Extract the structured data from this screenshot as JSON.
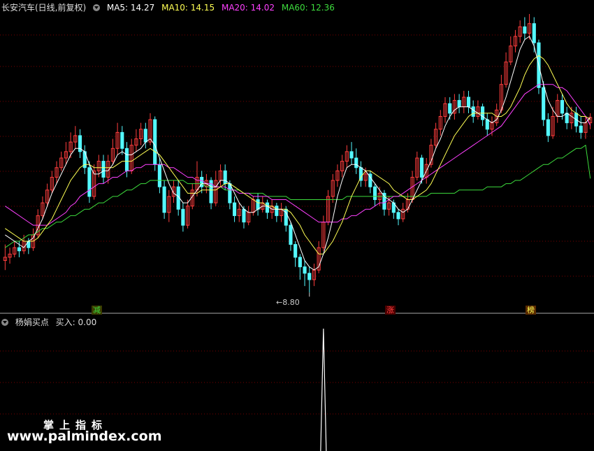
{
  "header_top": {
    "title": "长安汽车(日线,前复权)",
    "ma5_label": "MA5: 14.27",
    "ma10_label": "MA10: 14.15",
    "ma20_label": "MA20: 14.02",
    "ma60_label": "MA60: 12.36"
  },
  "header_bottom": {
    "title": "杨娟买点",
    "value_label": "买入: 0.00"
  },
  "annotations": {
    "low_marker": "←8.80",
    "badge_1": "减",
    "badge_2": "涨",
    "badge_3": "榜"
  },
  "watermark": {
    "line1": "掌上指标",
    "line2": "www.palmindex.com"
  },
  "colors": {
    "up": "#ff3d3d",
    "down": "#54f8ff",
    "ma5": "#ffffff",
    "ma10": "#ffff54",
    "ma20": "#ff40ff",
    "ma60": "#3ddc3d",
    "grid": "#7a0000",
    "divider": "#aaaaaa"
  },
  "chart_data": {
    "type": "candlestick",
    "ylim": [
      8.5,
      17.5
    ],
    "low_value": 8.8,
    "candles": [
      [
        9.8,
        9.9,
        9.5,
        10.3
      ],
      [
        9.9,
        10.0,
        9.7,
        10.2
      ],
      [
        10.0,
        10.2,
        9.9,
        10.4
      ],
      [
        10.2,
        10.1,
        9.9,
        10.4
      ],
      [
        10.1,
        10.4,
        10.0,
        10.6
      ],
      [
        10.4,
        10.2,
        10.0,
        10.5
      ],
      [
        10.2,
        10.6,
        10.1,
        10.8
      ],
      [
        10.6,
        11.2,
        10.5,
        11.4
      ],
      [
        11.2,
        11.6,
        11.1,
        11.8
      ],
      [
        11.6,
        12.0,
        11.5,
        12.2
      ],
      [
        12.0,
        12.4,
        11.9,
        12.6
      ],
      [
        12.4,
        12.7,
        12.2,
        12.9
      ],
      [
        12.7,
        13.0,
        12.6,
        13.2
      ],
      [
        13.0,
        13.2,
        12.8,
        13.5
      ],
      [
        13.2,
        13.5,
        13.0,
        13.8
      ],
      [
        13.5,
        13.7,
        13.3,
        14.0
      ],
      [
        13.7,
        13.2,
        13.0,
        13.9
      ],
      [
        13.2,
        12.7,
        12.5,
        13.4
      ],
      [
        12.7,
        11.8,
        11.6,
        12.9
      ],
      [
        11.8,
        12.6,
        11.7,
        12.8
      ],
      [
        12.6,
        12.9,
        12.4,
        13.1
      ],
      [
        12.9,
        12.4,
        12.2,
        13.1
      ],
      [
        12.4,
        12.9,
        12.2,
        13.1
      ],
      [
        12.9,
        13.3,
        12.8,
        13.6
      ],
      [
        13.3,
        13.8,
        13.1,
        14.1
      ],
      [
        13.8,
        13.3,
        13.1,
        14.0
      ],
      [
        13.3,
        12.6,
        12.4,
        13.5
      ],
      [
        12.6,
        13.4,
        12.5,
        13.6
      ],
      [
        13.4,
        13.6,
        13.2,
        13.9
      ],
      [
        13.6,
        13.9,
        13.4,
        14.1
      ],
      [
        13.9,
        13.5,
        13.3,
        14.1
      ],
      [
        13.5,
        14.2,
        13.4,
        14.4
      ],
      [
        14.2,
        12.8,
        12.6,
        14.3
      ],
      [
        12.8,
        12.1,
        11.9,
        13.0
      ],
      [
        12.1,
        11.3,
        11.1,
        12.3
      ],
      [
        11.3,
        11.8,
        11.0,
        12.0
      ],
      [
        11.8,
        12.1,
        11.6,
        12.3
      ],
      [
        12.1,
        11.4,
        11.2,
        12.3
      ],
      [
        11.4,
        10.9,
        10.7,
        11.6
      ],
      [
        10.9,
        11.5,
        10.8,
        11.7
      ],
      [
        11.5,
        12.0,
        11.4,
        12.2
      ],
      [
        12.0,
        12.4,
        11.8,
        12.9
      ],
      [
        12.4,
        12.1,
        11.9,
        12.6
      ],
      [
        12.1,
        12.3,
        11.9,
        12.5
      ],
      [
        12.3,
        11.6,
        11.4,
        12.4
      ],
      [
        11.6,
        12.3,
        11.5,
        12.6
      ],
      [
        12.3,
        12.6,
        12.1,
        12.8
      ],
      [
        12.6,
        12.2,
        12.0,
        12.8
      ],
      [
        12.2,
        11.6,
        11.4,
        12.3
      ],
      [
        11.6,
        11.2,
        11.0,
        11.8
      ],
      [
        11.2,
        11.4,
        11.0,
        11.6
      ],
      [
        11.4,
        11.0,
        10.8,
        11.5
      ],
      [
        11.0,
        11.3,
        10.9,
        11.5
      ],
      [
        11.3,
        11.7,
        11.2,
        11.8
      ],
      [
        11.7,
        11.4,
        11.2,
        11.9
      ],
      [
        11.4,
        11.6,
        11.3,
        11.8
      ],
      [
        11.6,
        11.3,
        11.1,
        11.7
      ],
      [
        11.3,
        11.5,
        11.1,
        11.7
      ],
      [
        11.5,
        11.2,
        11.0,
        11.6
      ],
      [
        11.2,
        11.4,
        11.0,
        11.6
      ],
      [
        11.4,
        10.9,
        10.7,
        11.5
      ],
      [
        10.9,
        10.3,
        10.1,
        11.0
      ],
      [
        10.3,
        9.9,
        9.6,
        10.4
      ],
      [
        9.9,
        9.6,
        9.2,
        10.0
      ],
      [
        9.6,
        9.4,
        9.0,
        9.8
      ],
      [
        9.4,
        9.2,
        8.8,
        9.6
      ],
      [
        9.2,
        9.5,
        9.0,
        9.7
      ],
      [
        9.5,
        10.2,
        9.4,
        10.4
      ],
      [
        10.2,
        11.0,
        10.1,
        11.2
      ],
      [
        11.0,
        11.8,
        10.9,
        12.0
      ],
      [
        11.8,
        12.3,
        11.6,
        12.5
      ],
      [
        12.3,
        12.6,
        12.1,
        12.8
      ],
      [
        12.6,
        12.9,
        12.4,
        13.1
      ],
      [
        12.9,
        13.2,
        12.7,
        13.4
      ],
      [
        13.2,
        13.0,
        12.8,
        13.5
      ],
      [
        13.0,
        12.7,
        12.5,
        13.3
      ],
      [
        12.7,
        12.3,
        12.1,
        12.9
      ],
      [
        12.3,
        12.5,
        12.1,
        12.7
      ],
      [
        12.5,
        12.1,
        11.9,
        12.6
      ],
      [
        12.1,
        11.7,
        11.5,
        12.2
      ],
      [
        11.7,
        11.9,
        11.5,
        12.1
      ],
      [
        11.9,
        11.4,
        11.2,
        12.0
      ],
      [
        11.4,
        11.6,
        11.2,
        11.8
      ],
      [
        11.6,
        11.3,
        11.1,
        11.7
      ],
      [
        11.3,
        11.1,
        10.9,
        11.4
      ],
      [
        11.1,
        11.4,
        11.0,
        11.6
      ],
      [
        11.4,
        11.7,
        11.3,
        11.9
      ],
      [
        11.7,
        12.4,
        11.6,
        12.6
      ],
      [
        12.4,
        13.0,
        12.3,
        13.2
      ],
      [
        13.0,
        12.4,
        12.2,
        13.1
      ],
      [
        12.4,
        12.8,
        12.2,
        13.0
      ],
      [
        12.8,
        13.4,
        12.7,
        13.6
      ],
      [
        13.4,
        13.9,
        13.3,
        14.1
      ],
      [
        13.9,
        14.3,
        13.7,
        14.5
      ],
      [
        14.3,
        14.7,
        14.1,
        14.9
      ],
      [
        14.7,
        14.4,
        14.2,
        14.9
      ],
      [
        14.4,
        14.8,
        14.2,
        15.0
      ],
      [
        14.8,
        14.6,
        14.4,
        15.0
      ],
      [
        14.6,
        14.9,
        14.4,
        15.1
      ],
      [
        14.9,
        14.6,
        14.4,
        15.1
      ],
      [
        14.6,
        14.3,
        14.1,
        14.8
      ],
      [
        14.3,
        14.6,
        14.2,
        14.8
      ],
      [
        14.6,
        14.2,
        14.0,
        14.7
      ],
      [
        14.2,
        13.9,
        13.7,
        14.4
      ],
      [
        13.9,
        14.1,
        13.7,
        14.3
      ],
      [
        14.1,
        14.5,
        14.0,
        14.7
      ],
      [
        14.5,
        15.3,
        14.4,
        15.6
      ],
      [
        15.3,
        16.0,
        15.2,
        16.3
      ],
      [
        16.0,
        16.5,
        15.9,
        16.8
      ],
      [
        16.5,
        16.8,
        16.3,
        17.0
      ],
      [
        16.8,
        17.1,
        16.6,
        17.3
      ],
      [
        17.1,
        16.9,
        16.7,
        17.4
      ],
      [
        16.9,
        17.2,
        16.7,
        17.5
      ],
      [
        17.2,
        16.6,
        16.3,
        17.4
      ],
      [
        16.6,
        15.2,
        15.0,
        16.7
      ],
      [
        15.2,
        14.2,
        14.0,
        15.4
      ],
      [
        14.2,
        13.7,
        13.5,
        14.4
      ],
      [
        13.7,
        14.3,
        13.6,
        14.6
      ],
      [
        14.3,
        14.8,
        14.1,
        15.0
      ],
      [
        14.8,
        14.4,
        14.2,
        15.0
      ],
      [
        14.4,
        14.1,
        13.9,
        14.6
      ],
      [
        14.1,
        14.4,
        13.9,
        14.6
      ],
      [
        14.4,
        14.0,
        13.8,
        14.6
      ],
      [
        14.0,
        13.8,
        13.6,
        14.3
      ],
      [
        13.8,
        14.1,
        13.6,
        14.3
      ],
      [
        14.1,
        14.27,
        13.9,
        14.4
      ]
    ],
    "ma5": [
      10.6,
      10.5,
      10.4,
      10.3,
      10.2,
      10.4,
      10.5,
      10.8,
      11.1,
      11.5,
      11.9,
      12.2,
      12.5,
      12.8,
      13.1,
      13.3,
      13.3,
      13.2,
      12.8,
      12.5,
      12.5,
      12.6,
      12.6,
      12.8,
      13.1,
      13.2,
      13.1,
      13.1,
      13.2,
      13.3,
      13.5,
      13.6,
      13.4,
      13.0,
      12.6,
      12.2,
      11.9,
      11.8,
      11.6,
      11.6,
      11.8,
      12.0,
      12.2,
      12.2,
      12.1,
      12.1,
      12.3,
      12.3,
      12.2,
      11.9,
      11.6,
      11.4,
      11.3,
      11.3,
      11.4,
      11.5,
      11.5,
      11.4,
      11.4,
      11.4,
      11.3,
      11.0,
      10.6,
      10.2,
      9.8,
      9.6,
      9.5,
      9.6,
      10.0,
      10.5,
      11.1,
      11.8,
      12.3,
      12.7,
      12.8,
      12.8,
      12.7,
      12.6,
      12.4,
      12.2,
      12.0,
      11.8,
      11.7,
      11.6,
      11.4,
      11.3,
      11.4,
      11.7,
      12.0,
      12.3,
      12.6,
      12.9,
      13.3,
      13.6,
      14.0,
      14.3,
      14.5,
      14.6,
      14.6,
      14.6,
      14.5,
      14.4,
      14.3,
      14.2,
      14.1,
      14.2,
      14.5,
      14.9,
      15.4,
      15.9,
      16.4,
      16.7,
      16.8,
      16.5,
      15.9,
      15.3,
      14.8,
      14.5,
      14.3,
      14.3,
      14.4,
      14.3,
      14.2,
      14.1,
      14.1,
      14.27
    ],
    "ma10": [
      10.8,
      10.7,
      10.6,
      10.5,
      10.4,
      10.4,
      10.4,
      10.5,
      10.7,
      10.9,
      11.1,
      11.4,
      11.7,
      12.0,
      12.3,
      12.5,
      12.7,
      12.8,
      12.8,
      12.7,
      12.7,
      12.7,
      12.7,
      12.7,
      12.8,
      12.9,
      12.9,
      12.9,
      13.0,
      13.1,
      13.2,
      13.3,
      13.2,
      13.1,
      12.9,
      12.7,
      12.5,
      12.3,
      12.1,
      11.9,
      11.9,
      11.9,
      12.0,
      12.0,
      12.0,
      12.0,
      12.1,
      12.2,
      12.2,
      12.1,
      12.0,
      11.9,
      11.8,
      11.7,
      11.6,
      11.6,
      11.5,
      11.5,
      11.4,
      11.4,
      11.4,
      11.3,
      11.1,
      10.9,
      10.6,
      10.4,
      10.2,
      10.0,
      10.0,
      10.2,
      10.4,
      10.7,
      11.0,
      11.4,
      11.8,
      12.1,
      12.4,
      12.6,
      12.6,
      12.5,
      12.4,
      12.3,
      12.2,
      12.0,
      11.9,
      11.8,
      11.7,
      11.7,
      11.8,
      11.9,
      12.0,
      12.2,
      12.5,
      12.8,
      13.1,
      13.4,
      13.7,
      13.9,
      14.1,
      14.3,
      14.4,
      14.4,
      14.4,
      14.4,
      14.4,
      14.3,
      14.3,
      14.4,
      14.6,
      14.9,
      15.2,
      15.6,
      15.9,
      16.1,
      16.2,
      16.1,
      15.9,
      15.6,
      15.3,
      15.0,
      14.7,
      14.5,
      14.4,
      14.3,
      14.3,
      14.2,
      14.15
    ],
    "ma20": [
      11.5,
      11.4,
      11.3,
      11.2,
      11.1,
      11.0,
      10.9,
      10.9,
      10.9,
      10.9,
      11.0,
      11.1,
      11.2,
      11.3,
      11.5,
      11.6,
      11.8,
      11.9,
      12.0,
      12.1,
      12.2,
      12.2,
      12.3,
      12.4,
      12.4,
      12.5,
      12.6,
      12.6,
      12.7,
      12.7,
      12.8,
      12.8,
      12.8,
      12.8,
      12.8,
      12.7,
      12.7,
      12.6,
      12.5,
      12.4,
      12.4,
      12.3,
      12.3,
      12.2,
      12.2,
      12.1,
      12.1,
      12.1,
      12.0,
      12.0,
      11.9,
      11.9,
      11.9,
      11.8,
      11.8,
      11.8,
      11.8,
      11.7,
      11.7,
      11.7,
      11.7,
      11.6,
      11.5,
      11.4,
      11.3,
      11.2,
      11.1,
      11.0,
      11.0,
      11.0,
      11.0,
      11.0,
      11.1,
      11.1,
      11.2,
      11.2,
      11.3,
      11.4,
      11.4,
      11.5,
      11.6,
      11.6,
      11.7,
      11.8,
      11.8,
      11.9,
      12.0,
      12.1,
      12.2,
      12.3,
      12.4,
      12.5,
      12.6,
      12.7,
      12.8,
      12.9,
      13.0,
      13.1,
      13.2,
      13.3,
      13.4,
      13.5,
      13.6,
      13.7,
      13.8,
      13.9,
      14.0,
      14.2,
      14.4,
      14.6,
      14.8,
      15.0,
      15.1,
      15.2,
      15.3,
      15.3,
      15.3,
      15.3,
      15.2,
      15.2,
      15.1,
      14.9,
      14.7,
      14.5,
      14.3,
      14.02
    ],
    "ma60": [
      10.2,
      10.3,
      10.4,
      10.4,
      10.5,
      10.6,
      10.6,
      10.7,
      10.8,
      10.8,
      10.9,
      11.0,
      11.0,
      11.1,
      11.2,
      11.2,
      11.3,
      11.4,
      11.4,
      11.5,
      11.6,
      11.6,
      11.7,
      11.8,
      11.8,
      11.9,
      12.0,
      12.0,
      12.1,
      12.2,
      12.2,
      12.3,
      12.3,
      12.3,
      12.3,
      12.3,
      12.3,
      12.3,
      12.3,
      12.2,
      12.2,
      12.2,
      12.2,
      12.1,
      12.1,
      12.1,
      12.1,
      12.0,
      12.0,
      12.0,
      12.0,
      11.9,
      11.9,
      11.9,
      11.9,
      11.9,
      11.8,
      11.8,
      11.8,
      11.8,
      11.8,
      11.7,
      11.7,
      11.7,
      11.7,
      11.7,
      11.7,
      11.7,
      11.7,
      11.7,
      11.7,
      11.7,
      11.7,
      11.8,
      11.8,
      11.8,
      11.8,
      11.8,
      11.8,
      11.8,
      11.8,
      11.8,
      11.8,
      11.8,
      11.8,
      11.8,
      11.8,
      11.8,
      11.8,
      11.8,
      11.8,
      11.9,
      11.9,
      11.9,
      11.9,
      11.9,
      11.9,
      12.0,
      12.0,
      12.0,
      12.0,
      12.0,
      12.0,
      12.1,
      12.1,
      12.1,
      12.1,
      12.2,
      12.2,
      12.3,
      12.3,
      12.4,
      12.5,
      12.6,
      12.7,
      12.8,
      12.8,
      12.9,
      13.0,
      13.0,
      13.1,
      13.2,
      13.3,
      13.3,
      13.4,
      12.36
    ],
    "signal_index": 68
  }
}
